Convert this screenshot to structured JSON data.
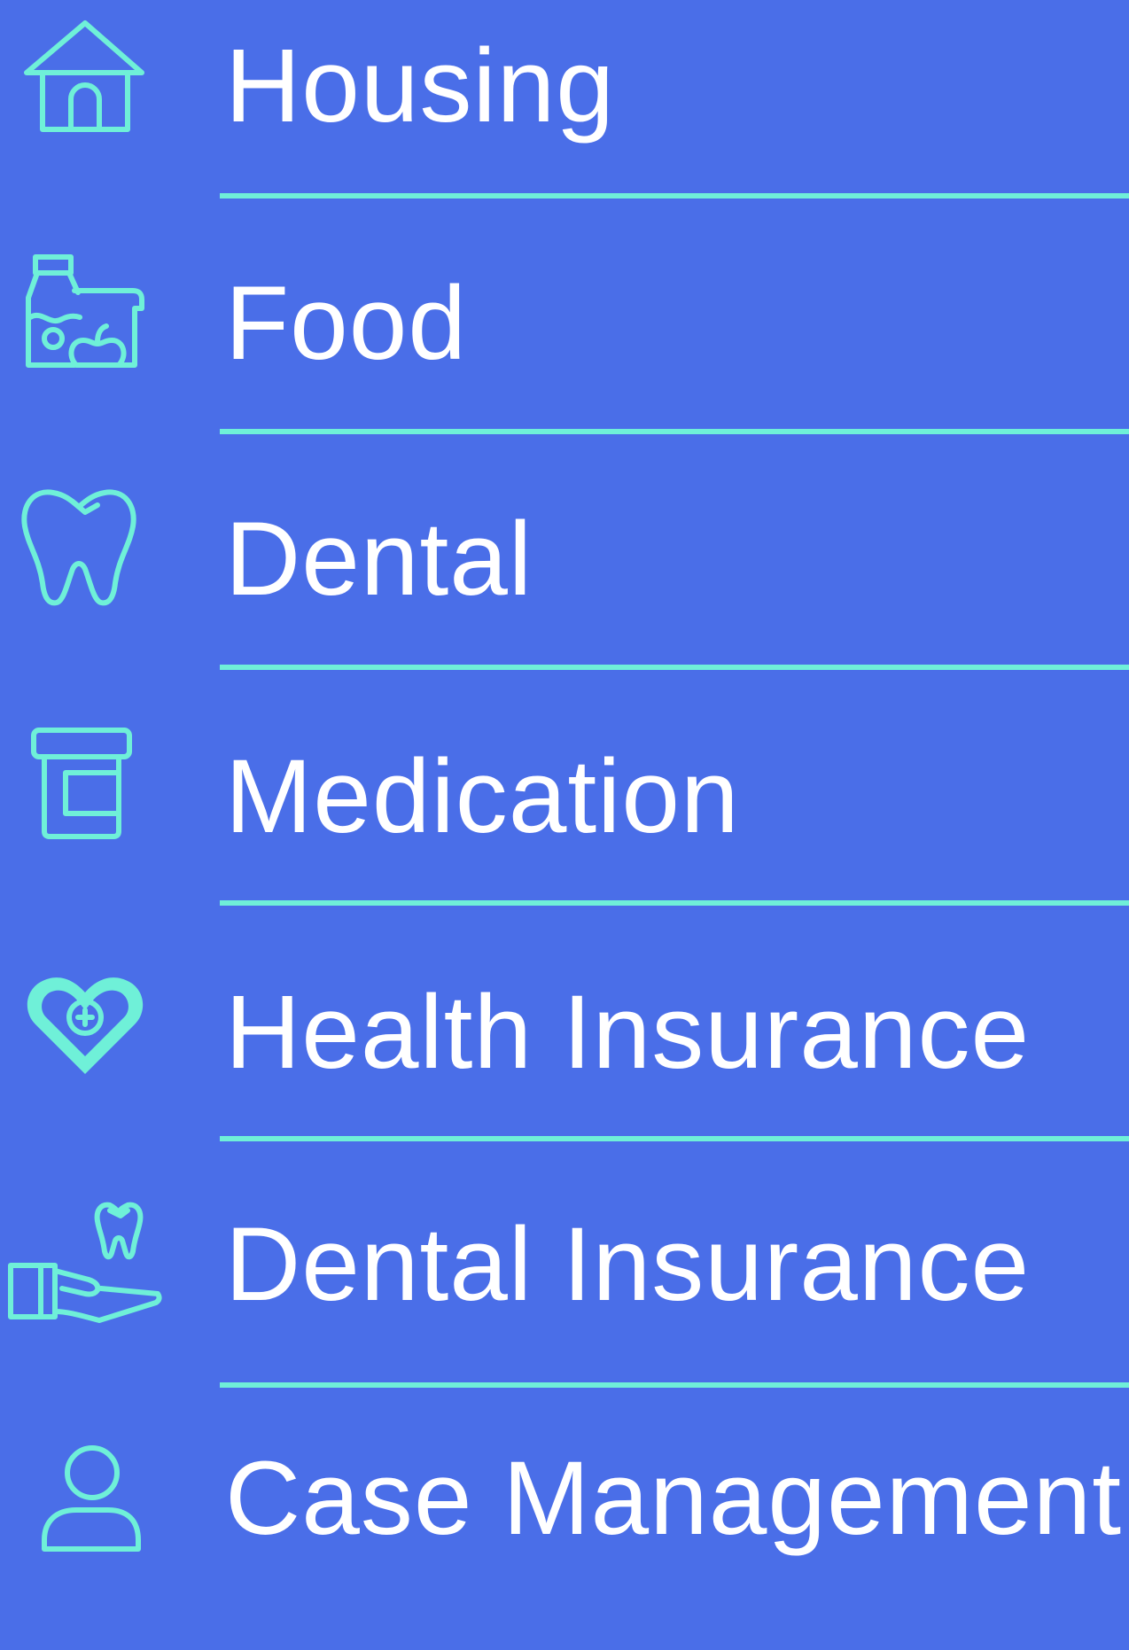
{
  "menu": {
    "items": [
      {
        "label": "Housing",
        "icon": "house-icon"
      },
      {
        "label": "Food",
        "icon": "groceries-icon"
      },
      {
        "label": "Dental",
        "icon": "tooth-icon"
      },
      {
        "label": "Medication",
        "icon": "pill-bottle-icon"
      },
      {
        "label": "Health Insurance",
        "icon": "heart-plus-icon"
      },
      {
        "label": "Dental Insurance",
        "icon": "hand-tooth-icon"
      },
      {
        "label": "Case Management",
        "icon": "person-icon"
      }
    ]
  },
  "colors": {
    "background": "#4a6ee8",
    "accent": "#6ff0d8",
    "text": "#ffffff"
  }
}
